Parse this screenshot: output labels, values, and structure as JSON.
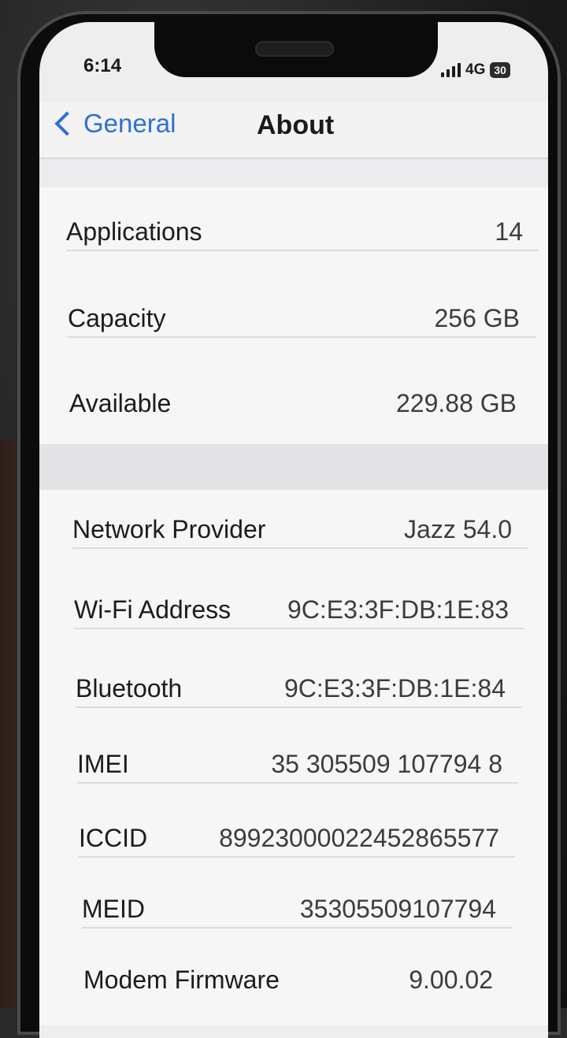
{
  "status_bar": {
    "time": "6:14",
    "network": "4G",
    "battery": "30"
  },
  "nav": {
    "back_label": "General",
    "title": "About"
  },
  "storage": [
    {
      "label": "Applications",
      "value": "14"
    },
    {
      "label": "Capacity",
      "value": "256 GB"
    },
    {
      "label": "Available",
      "value": "229.88 GB"
    }
  ],
  "device_info": [
    {
      "label": "Network Provider",
      "value": "Jazz 54.0"
    },
    {
      "label": "Wi-Fi Address",
      "value": "9C:E3:3F:DB:1E:83"
    },
    {
      "label": "Bluetooth",
      "value": "9C:E3:3F:DB:1E:84"
    },
    {
      "label": "IMEI",
      "value": "35 305509 107794 8"
    },
    {
      "label": "ICCID",
      "value": "89923000022452865577"
    },
    {
      "label": "MEID",
      "value": "35305509107794"
    },
    {
      "label": "Modem Firmware",
      "value": "9.00.02"
    }
  ]
}
